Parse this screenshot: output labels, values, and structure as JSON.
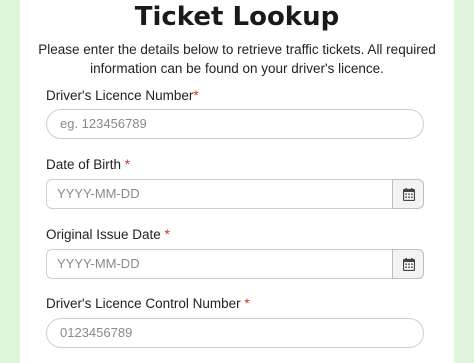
{
  "page": {
    "title": "Ticket Lookup",
    "description": "Please enter the details below to retrieve traffic tickets. All required information can be found on your driver's licence."
  },
  "form": {
    "licence_number": {
      "label": "Driver's Licence Number",
      "required_mark": "*",
      "placeholder": "eg. 123456789"
    },
    "date_of_birth": {
      "label": "Date of Birth ",
      "required_mark": "*",
      "placeholder": "YYYY-MM-DD",
      "button_icon": "calendar-icon"
    },
    "issue_date": {
      "label": "Original Issue Date ",
      "required_mark": "*",
      "placeholder": "YYYY-MM-DD",
      "button_icon": "calendar-icon"
    },
    "control_number": {
      "label": "Driver's Licence Control Number ",
      "required_mark": "*",
      "placeholder": "0123456789"
    }
  },
  "colors": {
    "background": "#dff5dc",
    "card": "#ffffff",
    "required": "#d0312d",
    "border": "#cfcfcf"
  }
}
